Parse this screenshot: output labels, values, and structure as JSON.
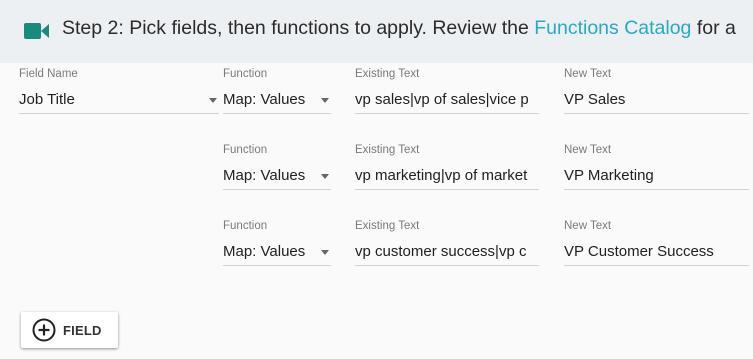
{
  "header": {
    "icon": "video-camera-icon",
    "title_prefix": "Step 2: Pick fields, then functions to apply. Review the ",
    "link_text": "Functions Catalog",
    "title_suffix": " for a"
  },
  "field": {
    "label": "Field Name",
    "value": "Job Title"
  },
  "rows": [
    {
      "function_label": "Function",
      "function_value": "Map: Values",
      "existing_label": "Existing Text",
      "existing_value": "vp sales|vp of sales|vice p",
      "new_label": "New Text",
      "new_value": "VP Sales"
    },
    {
      "function_label": "Function",
      "function_value": "Map: Values",
      "existing_label": "Existing Text",
      "existing_value": "vp marketing|vp of market",
      "new_label": "New Text",
      "new_value": "VP Marketing"
    },
    {
      "function_label": "Function",
      "function_value": "Map: Values",
      "existing_label": "Existing Text",
      "existing_value": "vp customer success|vp c",
      "new_label": "New Text",
      "new_value": "VP Customer Success"
    }
  ],
  "add_button": {
    "icon": "plus-circle-icon",
    "label": "FIELD"
  },
  "colors": {
    "accent": "#26a9c4",
    "header_bg": "#edf0f3",
    "icon": "#1a8a7e"
  }
}
